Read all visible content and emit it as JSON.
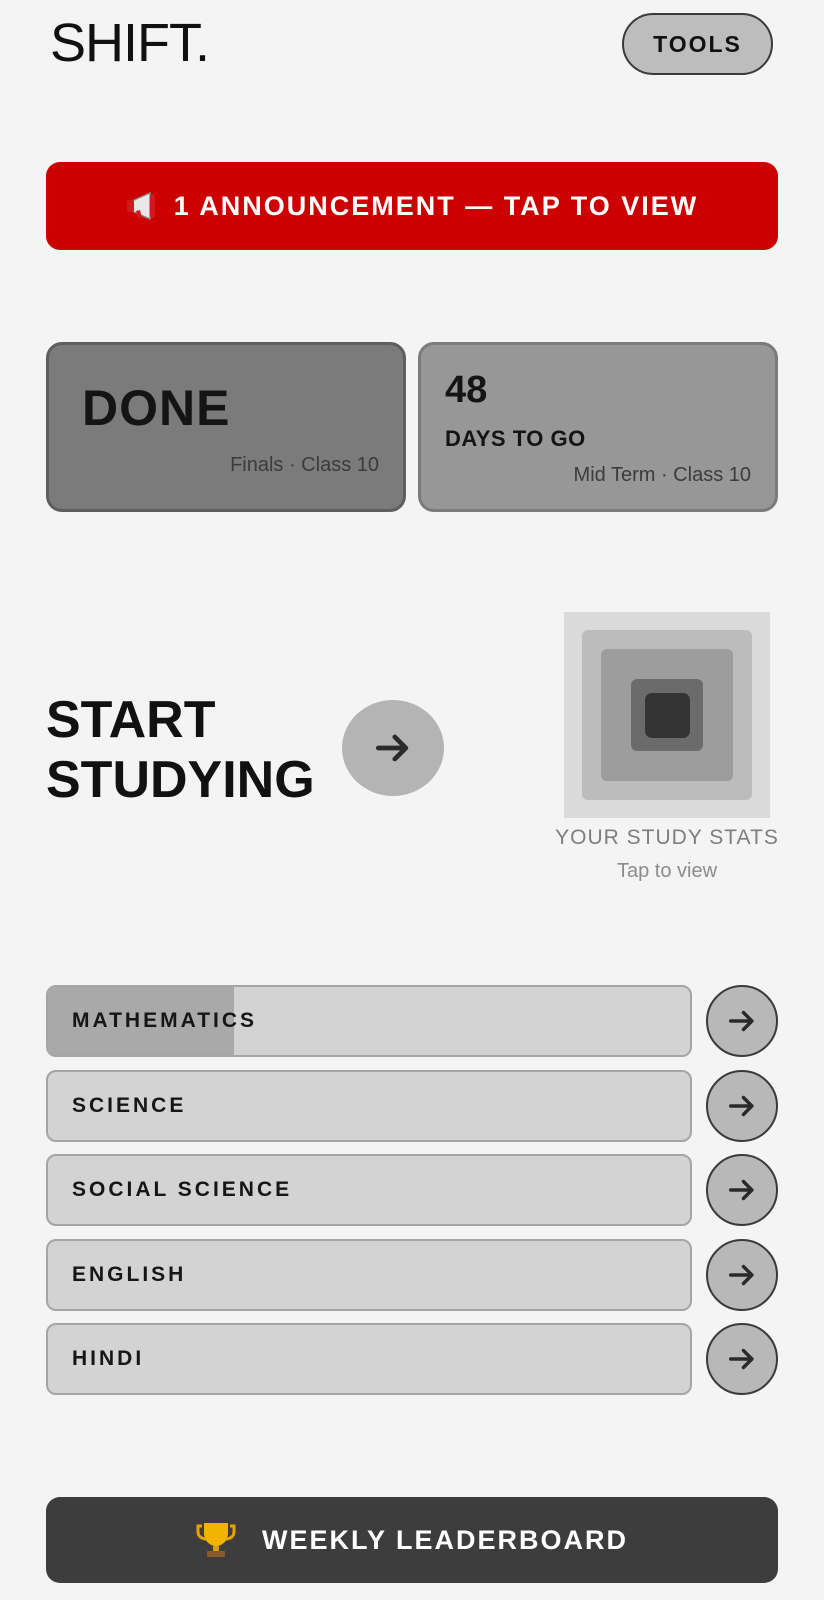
{
  "header": {
    "logo": "SHIFT.",
    "tools_label": "TOOLS"
  },
  "announcement": {
    "icon": "megaphone-icon",
    "label": "1 ANNOUNCEMENT — TAP TO VIEW",
    "color": "#cc0000"
  },
  "countdown": {
    "finals": {
      "status": "DONE",
      "meta": "Finals · Class 10"
    },
    "midterm": {
      "days": "48",
      "label": "DAYS TO GO",
      "meta": "Mid Term · Class 10"
    }
  },
  "start": {
    "title_line1": "START",
    "title_line2": "STUDYING",
    "arrow_icon": "arrow-right-icon"
  },
  "stats": {
    "title": "YOUR STUDY STATS",
    "subtitle": "Tap to view"
  },
  "subjects": [
    {
      "label": "MATHEMATICS",
      "progress": 0.29
    },
    {
      "label": "SCIENCE",
      "progress": 0
    },
    {
      "label": "SOCIAL SCIENCE",
      "progress": 0
    },
    {
      "label": "ENGLISH",
      "progress": 0
    },
    {
      "label": "HINDI",
      "progress": 0
    }
  ],
  "leaderboard": {
    "icon": "trophy-icon",
    "label": "WEEKLY LEADERBOARD"
  }
}
